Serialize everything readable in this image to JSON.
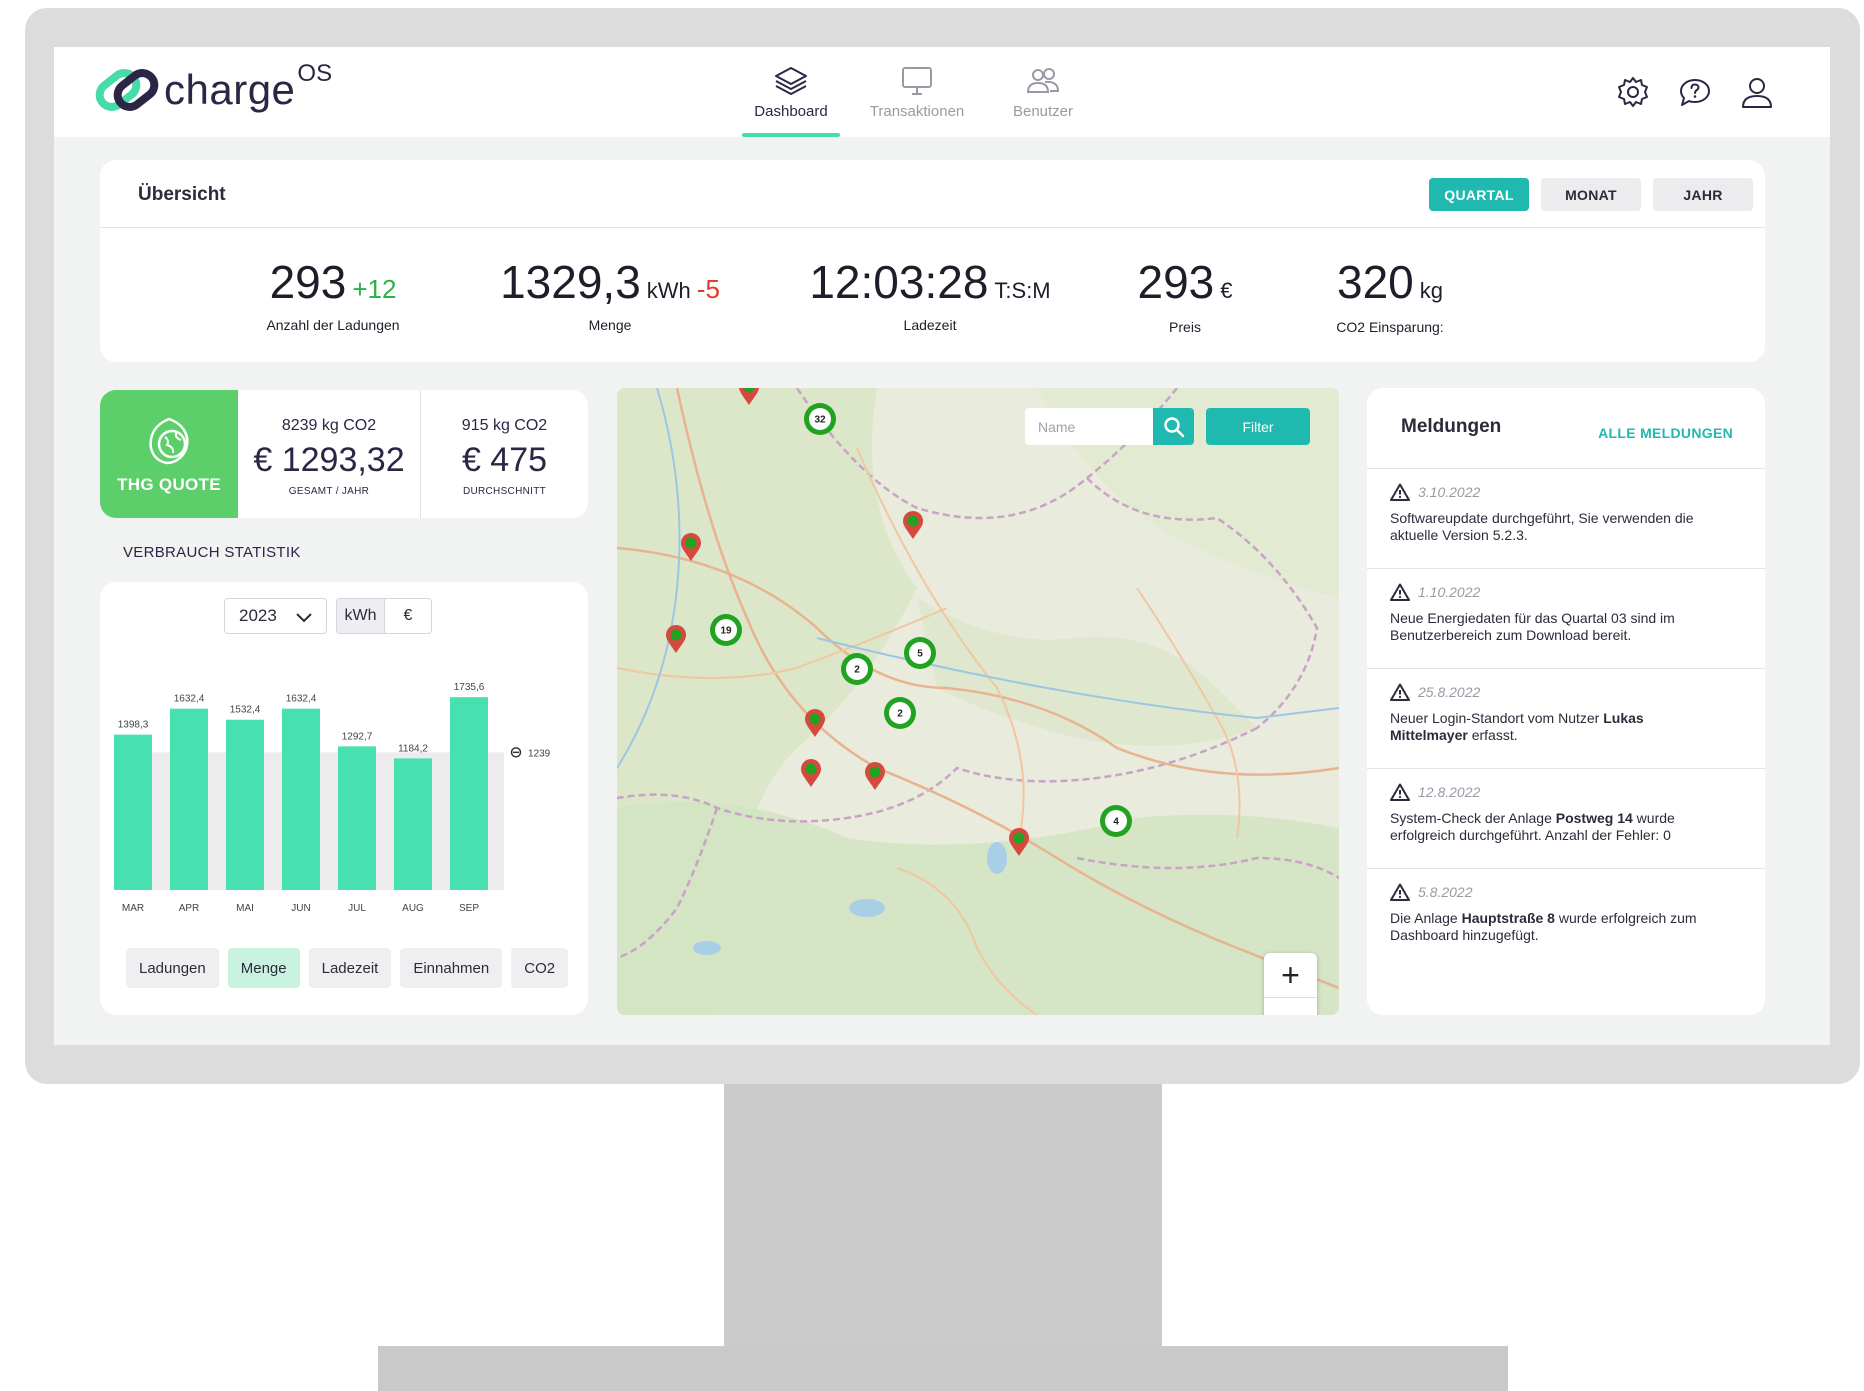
{
  "app": {
    "brand": "charge",
    "brand_sup": "OS"
  },
  "nav": {
    "tabs": [
      {
        "label": "Dashboard",
        "icon": "layers-icon",
        "active": true
      },
      {
        "label": "Transaktionen",
        "icon": "monitor-icon",
        "active": false
      },
      {
        "label": "Benutzer",
        "icon": "users-icon",
        "active": false
      }
    ]
  },
  "header_icons": [
    "gear-icon",
    "help-chat-icon",
    "user-icon"
  ],
  "overview": {
    "title": "Übersicht",
    "periods": [
      "QUARTAL",
      "MONAT",
      "JAHR"
    ],
    "active_period": "QUARTAL",
    "kpis": [
      {
        "value": "293",
        "unit": "",
        "delta": "+12",
        "delta_dir": "up",
        "label": "Anzahl der Ladungen"
      },
      {
        "value": "1329,3",
        "unit": "kWh",
        "delta": "-5",
        "delta_dir": "down",
        "label": "Menge"
      },
      {
        "value": "12:03:28",
        "unit": "T:S:M",
        "delta": "",
        "delta_dir": "",
        "label": "Ladezeit"
      },
      {
        "value": "293",
        "unit": "€",
        "delta": "",
        "delta_dir": "",
        "label": "Preis"
      },
      {
        "value": "320",
        "unit": "kg",
        "delta": "",
        "delta_dir": "",
        "label": "CO2 Einsparung:"
      }
    ]
  },
  "thg": {
    "badge_label": "THG QUOTE",
    "badge_icon": "globe-leaf-icon",
    "total": {
      "co2": "8239 kg CO2",
      "amount": "€ 1293,32",
      "caption": "GESAMT / JAHR"
    },
    "average": {
      "co2": "915 kg CO2",
      "amount": "€ 475",
      "caption": "DURCHSCHNITT"
    }
  },
  "stats": {
    "title": "VERBRAUCH STATISTIK",
    "year": "2023",
    "units": [
      "kWh",
      "€"
    ],
    "active_unit": "kWh",
    "metrics": [
      "Ladungen",
      "Menge",
      "Ladezeit",
      "Einnahmen",
      "CO2"
    ],
    "active_metric": "Menge"
  },
  "chart_data": {
    "type": "bar",
    "categories": [
      "MAR",
      "APR",
      "MAI",
      "JUN",
      "JUL",
      "AUG",
      "SEP"
    ],
    "values": [
      1398.3,
      1632.4,
      1532.4,
      1632.4,
      1292.7,
      1184.2,
      1735.6
    ],
    "value_labels": [
      "1398,3",
      "1632,4",
      "1532,4",
      "1632,4",
      "1292,7",
      "1184,2",
      "1735,6"
    ],
    "average": 1239,
    "average_label": "1239",
    "ylim": [
      0,
      1800
    ],
    "bar_color": "#47e0b0",
    "band_color": "#ececec"
  },
  "map": {
    "search_placeholder": "Name",
    "filter_label": "Filter",
    "zoom_in": "+",
    "zoom_out": "−",
    "clusters": [
      "32",
      "19",
      "2",
      "5",
      "2",
      "4"
    ]
  },
  "notifications": {
    "title": "Meldungen",
    "link": "ALLE MELDUNGEN",
    "items": [
      {
        "date": "3.10.2022",
        "pre": "Softwareupdate durchgeführt, Sie verwenden die aktuelle Version 5.2.3.",
        "bold": "",
        "post": ""
      },
      {
        "date": "1.10.2022",
        "pre": "Neue Energiedaten für das Quartal 03 sind im Benutzerbereich zum Download bereit.",
        "bold": "",
        "post": ""
      },
      {
        "date": "25.8.2022",
        "pre": "Neuer Login-Standort vom Nutzer ",
        "bold": "Lukas Mittelmayer",
        "post": " erfasst."
      },
      {
        "date": "12.8.2022",
        "pre": "System-Check der Anlage ",
        "bold": "Postweg 14",
        "post": " wurde erfolgreich durchgeführt. Anzahl der Fehler: 0"
      },
      {
        "date": "5.8.2022",
        "pre": "Die Anlage ",
        "bold": "Hauptstraße 8",
        "post": " wurde erfolgreich zum Dashboard hinzugefügt."
      }
    ]
  },
  "colors": {
    "accent_teal": "#1fb9b0",
    "accent_green": "#47dba8",
    "thg_green": "#5ccf6b",
    "delta_up": "#2bb24a",
    "delta_down": "#e23a2a"
  }
}
